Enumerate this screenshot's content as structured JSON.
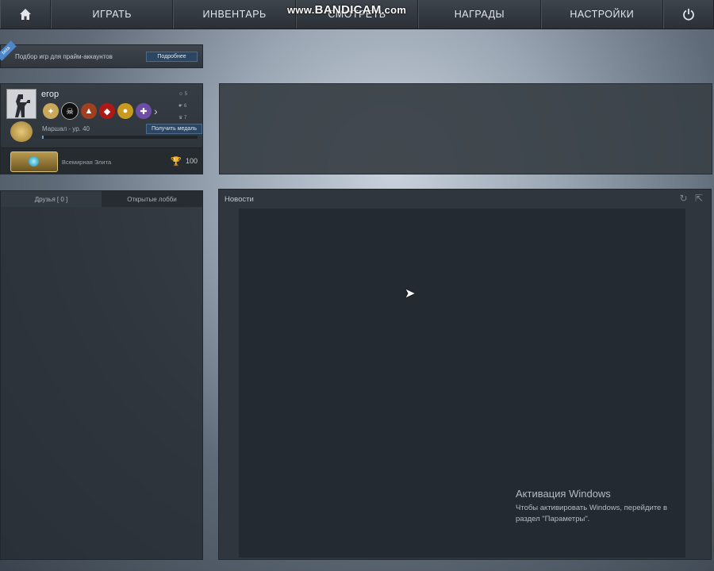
{
  "topbar": {
    "home_icon": "home-icon",
    "play": "ИГРАТЬ",
    "inventory": "ИНВЕНТАРЬ",
    "watch": "СМОТРЕТЬ",
    "awards": "НАГРАДЫ",
    "settings": "НАСТРОЙКИ",
    "power_icon": "power-icon"
  },
  "watermark": {
    "prefix": "www.",
    "brand": "BANDICAM",
    "suffix": ".com"
  },
  "prime": {
    "ribbon": "beta",
    "text": "Подбор игр для прайм-аккаунтов",
    "button": "Подробнее"
  },
  "profile": {
    "username": "егор",
    "stats": [
      "5",
      "6",
      "7"
    ],
    "rank": "Маршал - ур. 40",
    "get_medal_button": "Получить медаль",
    "xp_progress_percent": 1,
    "competitive_rank": "Всемирная Элита",
    "score": "100",
    "medal_icons": [
      "service-medal-icon",
      "skull-medal-icon",
      "operation-coin-icon",
      "red-coin-icon",
      "gold-coin-icon",
      "purple-coin-icon"
    ],
    "more_arrow": "›"
  },
  "friends": {
    "tab_friends": "Друзья [ 0 ]",
    "tab_lobbies": "Открытые лобби"
  },
  "news": {
    "title": "Новости",
    "refresh_icon": "refresh-icon",
    "external_icon": "external-link-icon"
  },
  "windows": {
    "title": "Активация Windows",
    "line1": "Чтобы активировать Windows, перейдите в",
    "line2": "раздел \"Параметры\"."
  },
  "colors": {
    "accent": "#6a9fd4",
    "button_blue": "#2c4560"
  }
}
